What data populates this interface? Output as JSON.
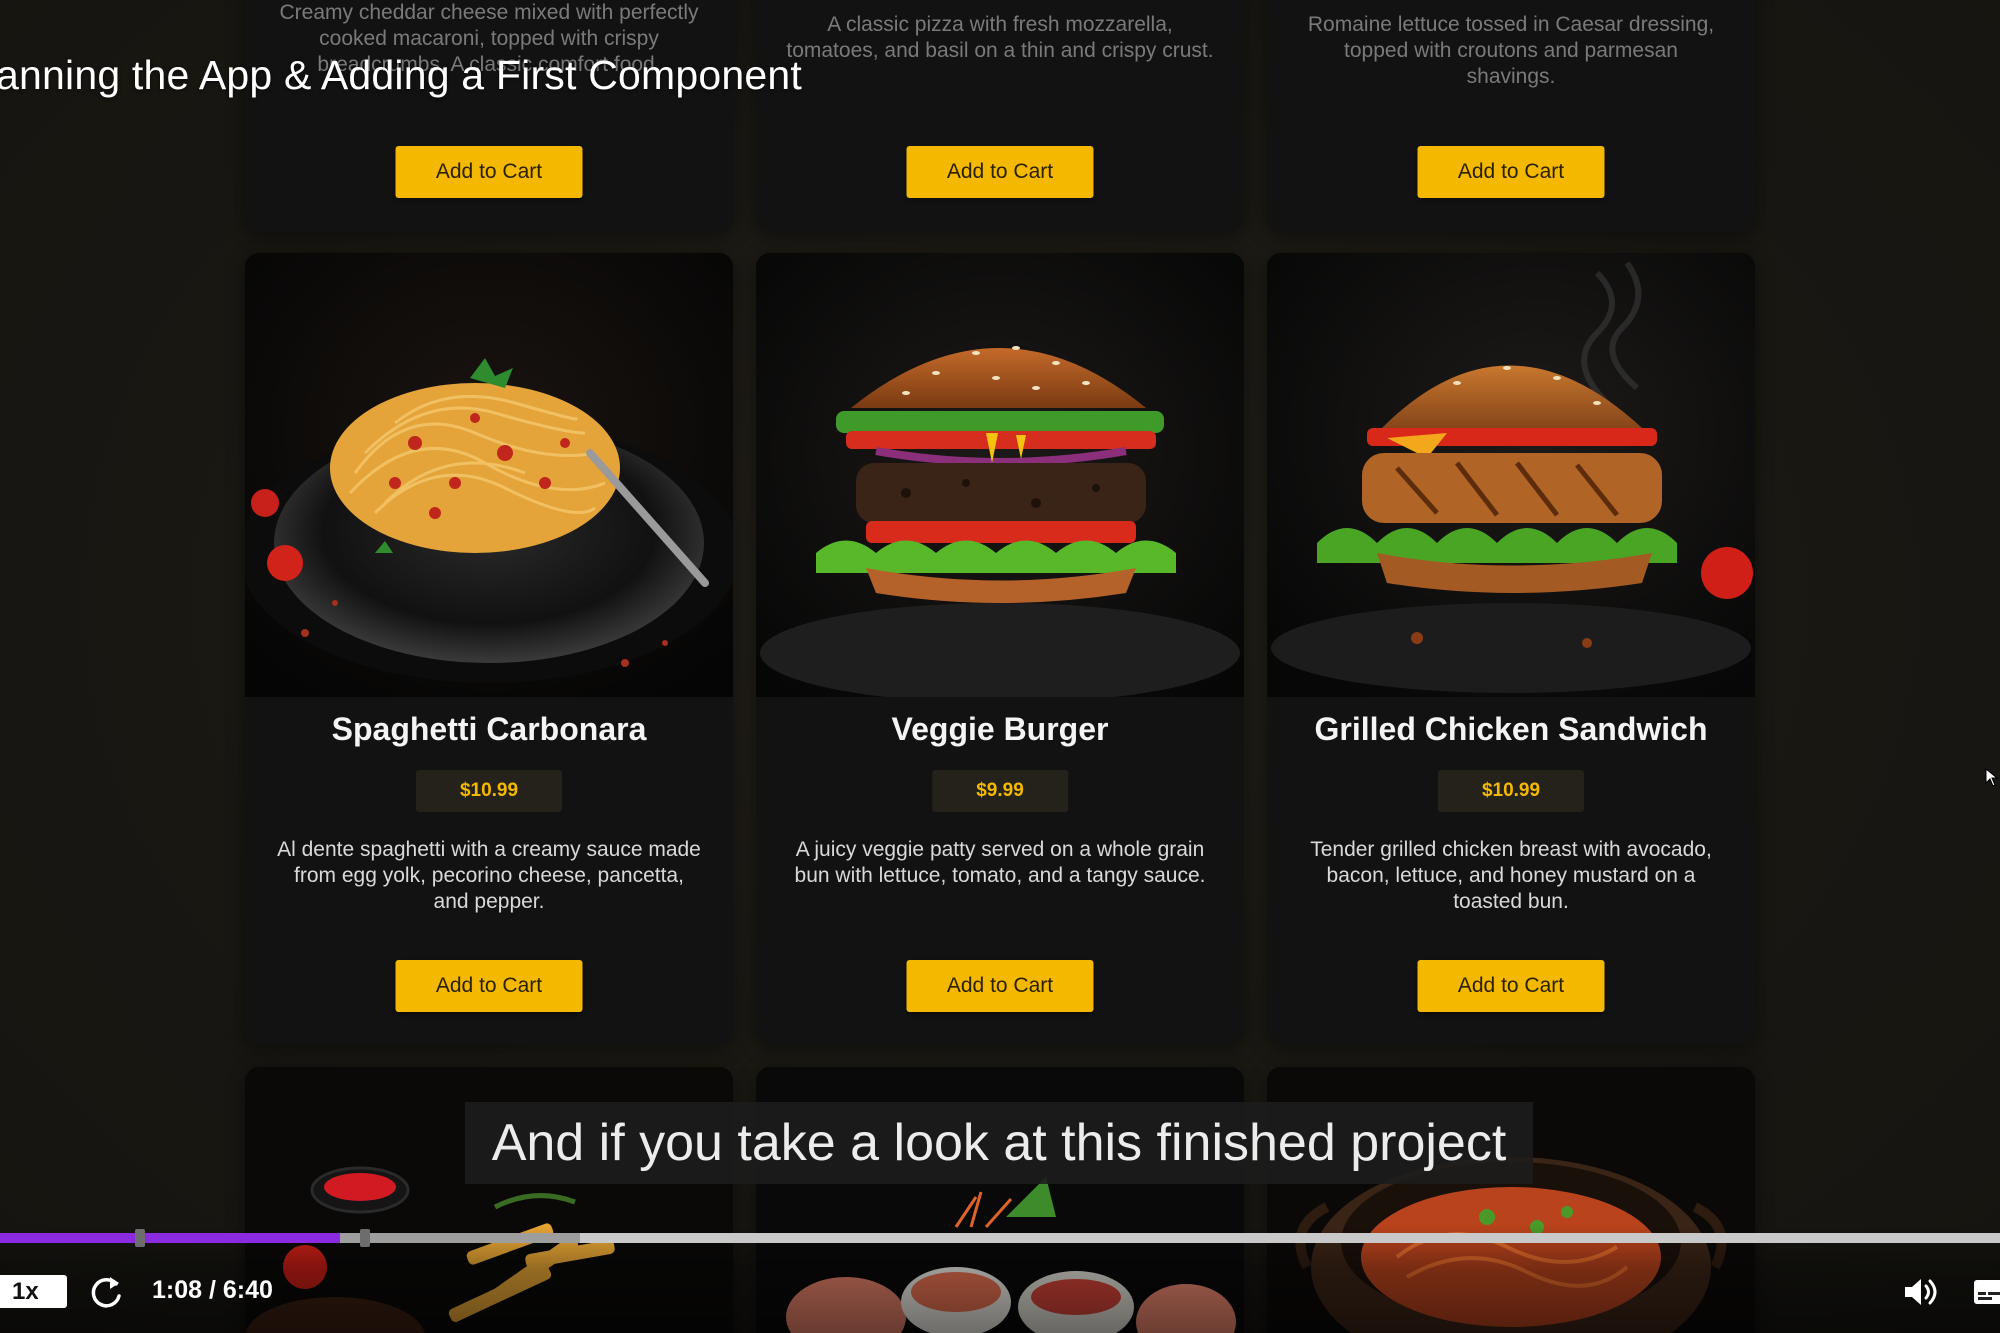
{
  "video": {
    "title": "anning the App & Adding a First Component",
    "caption": "And if you take a look at this finished project",
    "time": "1:08 / 6:40",
    "speed": "1x",
    "progress_fraction": 0.17,
    "buffered_fraction": 0.12
  },
  "menu": {
    "top_row": [
      {
        "description": "Creamy cheddar cheese mixed with perfectly cooked macaroni, topped with crispy breadcrumbs. A classic comfort food.",
        "button": "Add to Cart"
      },
      {
        "description": "A classic pizza with fresh mozzarella, tomatoes, and basil on a thin and crispy crust.",
        "button": "Add to Cart"
      },
      {
        "description": "Romaine lettuce tossed in Caesar dressing, topped with croutons and parmesan shavings.",
        "button": "Add to Cart"
      }
    ],
    "middle_row": [
      {
        "name": "Spaghetti Carbonara",
        "price": "$10.99",
        "description": "Al dente spaghetti with a creamy sauce made from egg yolk, pecorino cheese, pancetta, and pepper.",
        "button": "Add to Cart",
        "image_icon": "spaghetti-image"
      },
      {
        "name": "Veggie Burger",
        "price": "$9.99",
        "description": "A juicy veggie patty served on a whole grain bun with lettuce, tomato, and a tangy sauce.",
        "button": "Add to Cart",
        "image_icon": "burger-image"
      },
      {
        "name": "Grilled Chicken Sandwich",
        "price": "$10.99",
        "description": "Tender grilled chicken breast with avocado, bacon, lettuce, and honey mustard on a toasted bun.",
        "button": "Add to Cart",
        "image_icon": "chicken-sandwich-image"
      }
    ],
    "bottom_row": [
      {
        "image_icon": "steak-fries-image"
      },
      {
        "image_icon": "sushi-image"
      },
      {
        "image_icon": "noodle-bowl-image"
      }
    ]
  },
  "colors": {
    "accent": "#f5b800",
    "progress": "#8a2be2",
    "card_bg": "#121212",
    "page_bg": "#1b1915"
  },
  "icons": {
    "replay": "replay-icon",
    "volume": "volume-icon",
    "captions": "captions-icon",
    "cursor": "mouse-cursor-icon"
  }
}
